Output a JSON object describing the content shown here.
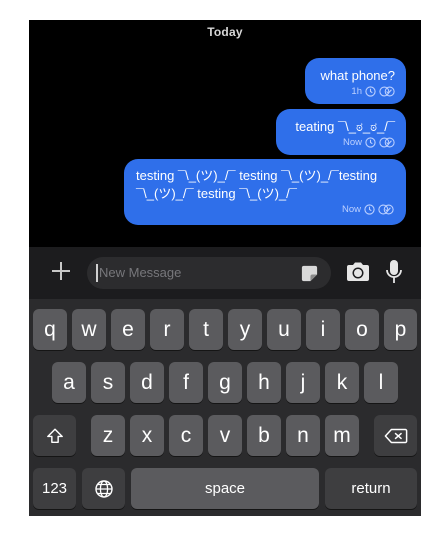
{
  "conversation": {
    "date_header": "Today",
    "messages": [
      {
        "text": "what phone?",
        "time": "1h"
      },
      {
        "text": "teating ¯\\_ಠ_ಠ_/¯",
        "time": "Now"
      },
      {
        "text": "testing ¯\\_(ツ)_/¯ testing ¯\\_(ツ)_/¯testing ¯\\_(ツ)_/¯ testing ¯\\_(ツ)_/¯",
        "time": "Now"
      }
    ]
  },
  "composer": {
    "placeholder": "New Message",
    "icons": [
      "plus-icon",
      "sticker-icon",
      "camera-icon",
      "microphone-icon"
    ]
  },
  "keyboard": {
    "row1": [
      "q",
      "w",
      "e",
      "r",
      "t",
      "y",
      "u",
      "i",
      "o",
      "p"
    ],
    "row2": [
      "a",
      "s",
      "d",
      "f",
      "g",
      "h",
      "j",
      "k",
      "l"
    ],
    "row3": [
      "z",
      "x",
      "c",
      "v",
      "b",
      "n",
      "m"
    ],
    "numbers_label": "123",
    "space_label": "space",
    "return_label": "return",
    "icons": [
      "shift-icon",
      "backspace-icon",
      "globe-icon"
    ]
  },
  "colors": {
    "bubble": "#2f6fea",
    "background": "#000000",
    "key": "#5b5b5e",
    "key_dark": "#3e3e40"
  }
}
